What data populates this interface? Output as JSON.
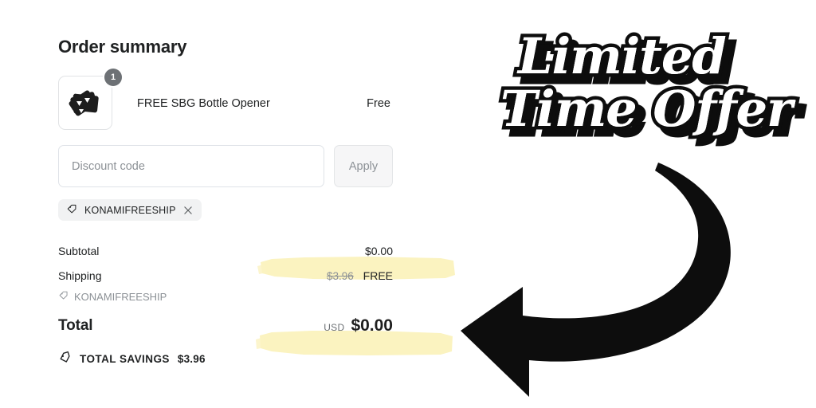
{
  "summary": {
    "title": "Order summary",
    "line_item": {
      "quantity": "1",
      "name": "FREE SBG Bottle Opener",
      "price": "Free",
      "thumbnail_icon": "bottle-opener-cards-image"
    },
    "discount": {
      "placeholder": "Discount code",
      "value": "",
      "apply_label": "Apply",
      "applied_codes": [
        {
          "code": "KONAMIFREESHIP",
          "tag_icon": "tag-icon",
          "remove_icon": "close-icon"
        }
      ]
    },
    "totals": {
      "subtotal_label": "Subtotal",
      "subtotal_value": "$0.00",
      "shipping_label": "Shipping",
      "shipping_old_value": "$3.96",
      "shipping_value": "FREE",
      "shipping_discount_code": "KONAMIFREESHIP",
      "shipping_discount_icon": "tag-icon",
      "total_label": "Total",
      "total_currency": "USD",
      "total_value": "$0.00",
      "savings_icon": "tag-savings-icon",
      "savings_label": "TOTAL SAVINGS",
      "savings_value": "$3.96"
    }
  },
  "promo": {
    "headline_line1": "Limited",
    "headline_line2": "Time Offer",
    "arrow_icon": "curved-arrow-left-icon"
  },
  "colors": {
    "background": "#ffffff",
    "text": "#202223",
    "muted_text": "#8c9196",
    "highlight_yellow": "#fbf3c0",
    "badge_gray": "#6d7175",
    "pill_gray": "#f1f2f3",
    "promo_black": "#0d0d0d"
  }
}
